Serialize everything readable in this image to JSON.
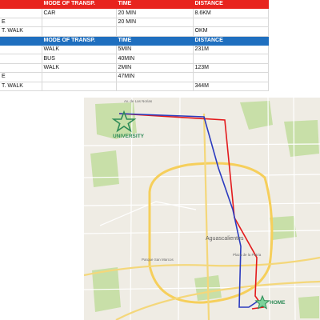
{
  "table1": {
    "header": [
      "",
      "MODE OF TRANSP.",
      "TIME",
      "DISTANCE"
    ],
    "rows": [
      [
        "",
        "CAR",
        "20 MIN",
        "8.6KM"
      ],
      [
        "E",
        "",
        "20 MIN",
        ""
      ],
      [
        "T. WALK",
        "",
        "",
        "OKM"
      ]
    ]
  },
  "table2": {
    "header": [
      "",
      "MODE OF TRANSP.",
      "TIME",
      "DISTANCE"
    ],
    "rows": [
      [
        "",
        "WALK",
        "5MIN",
        "231M"
      ],
      [
        "",
        "BUS",
        "40MIN",
        ""
      ],
      [
        "",
        "WALK",
        "2MIN",
        "123M"
      ],
      [
        "E",
        "",
        "47MIN",
        ""
      ],
      [
        "T. WALK",
        "",
        "",
        "344M"
      ]
    ]
  },
  "map": {
    "labels": {
      "university": "UNIVERSITY",
      "home": "HOME",
      "city": "Aguascalientes",
      "park": "Parque San Marcos",
      "top_left": "Av. de Las Norias",
      "plaza": "Plaza de la Patria"
    },
    "colors": {
      "car_route": "#e31a1c",
      "bus_route": "#2b3bbf",
      "star": "#2e8b57",
      "map_bg": "#efece4",
      "green": "#c8dfa8",
      "ring_road": "#f6cf5b",
      "main_road": "#ffffff"
    }
  }
}
